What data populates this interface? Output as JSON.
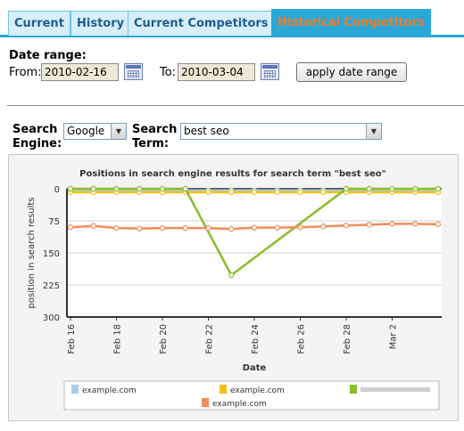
{
  "tabs": [
    {
      "label": "Current",
      "active": false
    },
    {
      "label": "History",
      "active": false
    },
    {
      "label": "Current Competitors",
      "active": false
    },
    {
      "label": "Historical Competitors",
      "active": true
    }
  ],
  "date_range": {
    "heading": "Date range:",
    "from_label": "From:",
    "from_value": "2010-02-16",
    "to_label": "To:",
    "to_value": "2010-03-04",
    "apply_label": "apply date range"
  },
  "search": {
    "engine_label_1": "Search",
    "engine_label_2": "Engine:",
    "engine_value": "Google",
    "term_label_1": "Search",
    "term_label_2": "Term:",
    "term_value": "best seo"
  },
  "icons": {
    "calendar": "calendar-icon",
    "dropdown": "chevron-down-icon"
  },
  "chart_data": {
    "type": "line",
    "title": "Positions in search engine results for search term \"best seo\"",
    "xlabel": "Date",
    "ylabel": "position in search results",
    "x": [
      "2010-02-16",
      "2010-02-17",
      "2010-02-18",
      "2010-02-19",
      "2010-02-20",
      "2010-02-21",
      "2010-02-22",
      "2010-02-23",
      "2010-02-24",
      "2010-02-25",
      "2010-02-26",
      "2010-02-27",
      "2010-02-28",
      "2010-03-01",
      "2010-03-02",
      "2010-03-03",
      "2010-03-04"
    ],
    "xticks": [
      "Feb 16",
      "Feb 18",
      "Feb 20",
      "Feb 22",
      "Feb 24",
      "Feb 26",
      "Feb 28",
      "Mar 2"
    ],
    "ylim": [
      0,
      300
    ],
    "yticks": [
      0,
      75,
      150,
      225,
      300
    ],
    "y_reversed": true,
    "grid": true,
    "legend_position": "bottom",
    "series": [
      {
        "name": "example.com",
        "color": "#a8cde9",
        "values": [
          4,
          4,
          4,
          4,
          4,
          4,
          4,
          4,
          4,
          4,
          4,
          4,
          4,
          4,
          4,
          4,
          4
        ]
      },
      {
        "name": "example.com",
        "color": "#f5c016",
        "values": [
          8,
          8,
          8,
          8,
          8,
          8,
          8,
          8,
          8,
          8,
          8,
          8,
          8,
          8,
          8,
          8,
          8
        ]
      },
      {
        "name": "",
        "color": "#8bbd2a",
        "values": [
          0,
          0,
          0,
          0,
          0,
          0,
          null,
          202,
          null,
          null,
          null,
          null,
          0,
          0,
          0,
          0,
          0
        ]
      },
      {
        "name": "example.com",
        "color": "#f08c5a",
        "values": [
          90,
          87,
          92,
          93,
          92,
          92,
          92,
          94,
          91,
          91,
          90,
          88,
          86,
          84,
          82,
          82,
          83
        ]
      }
    ]
  }
}
